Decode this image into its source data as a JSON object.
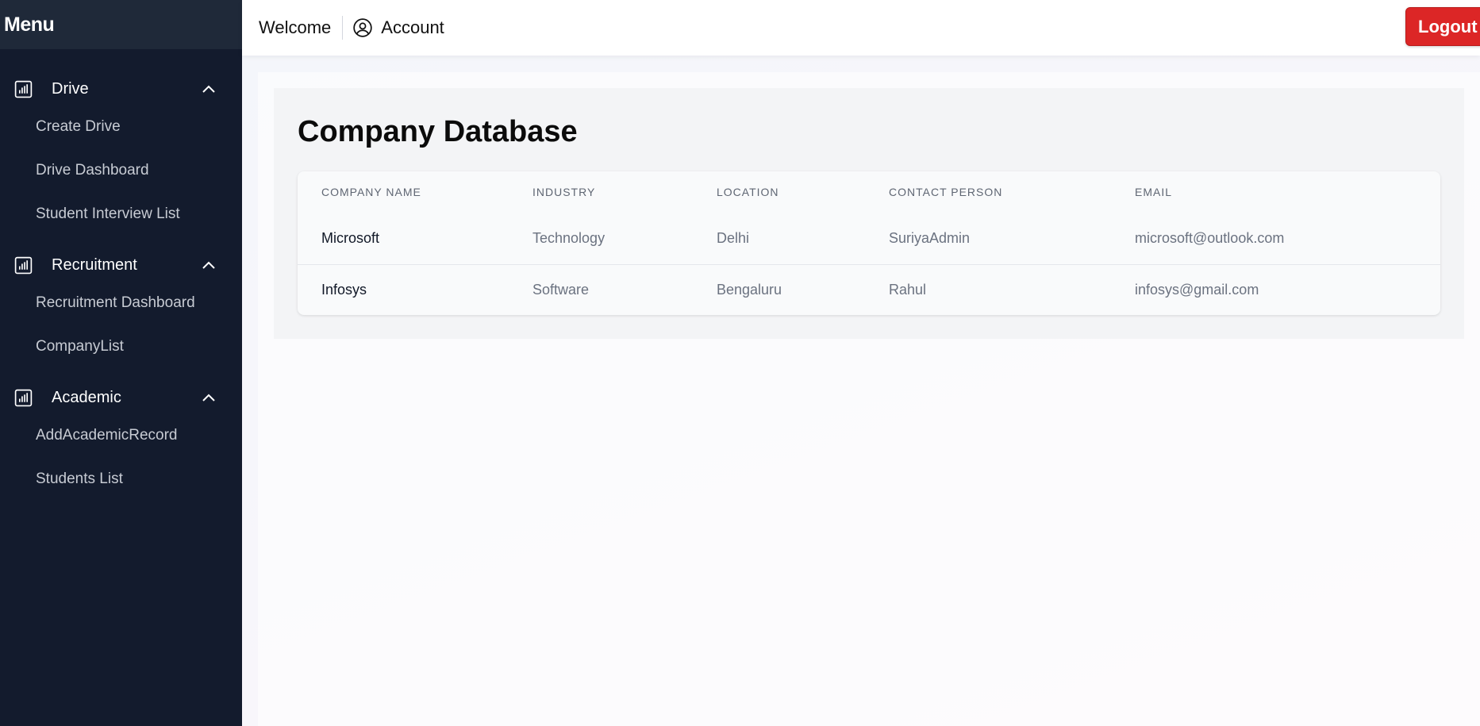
{
  "sidebar": {
    "title": "Menu",
    "groups": [
      {
        "label": "Drive",
        "icon": "bar-chart-icon",
        "items": [
          "Create Drive",
          "Drive Dashboard",
          "Student Interview List"
        ]
      },
      {
        "label": "Recruitment",
        "icon": "bar-chart-icon",
        "items": [
          "Recruitment Dashboard",
          "CompanyList"
        ]
      },
      {
        "label": "Academic",
        "icon": "bar-chart-icon",
        "items": [
          "AddAcademicRecord",
          "Students List"
        ]
      }
    ]
  },
  "topbar": {
    "welcome": "Welcome",
    "account_label": "Account",
    "account_icon": "user-circle-icon",
    "logout_label": "Logout"
  },
  "main": {
    "title": "Company Database",
    "table": {
      "headers": [
        "COMPANY NAME",
        "INDUSTRY",
        "LOCATION",
        "CONTACT PERSON",
        "EMAIL"
      ],
      "rows": [
        [
          "Microsoft",
          "Technology",
          "Delhi",
          "SuriyaAdmin",
          "microsoft@outlook.com"
        ],
        [
          "Infosys",
          "Software",
          "Bengaluru",
          "Rahul",
          "infosys@gmail.com"
        ]
      ]
    }
  },
  "colors": {
    "sidebar_bg": "#131b2d",
    "sidebar_header_bg": "#1f2939",
    "logout_bg": "#dc2626"
  }
}
